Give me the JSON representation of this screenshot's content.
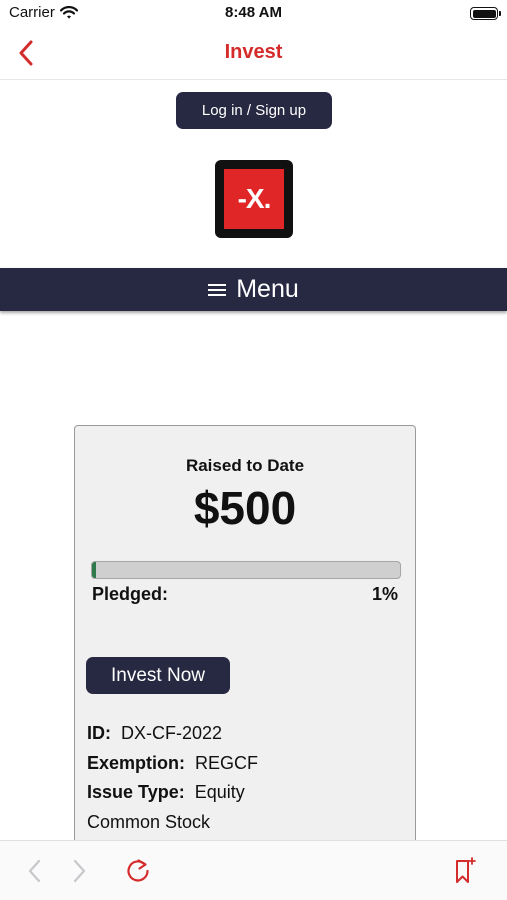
{
  "status_bar": {
    "carrier": "Carrier",
    "time": "8:48 AM"
  },
  "nav": {
    "title": "Invest",
    "accent_color": "#d42b2b"
  },
  "header": {
    "login_label": "Log in / Sign up",
    "logo_text": "-X."
  },
  "menu": {
    "label": "Menu",
    "bar_color": "#272842"
  },
  "campaign": {
    "raised_label": "Raised to Date",
    "raised_amount": "$500",
    "progress_fraction": 0.01,
    "pledged_label": "Pledged:",
    "pledged_percent": "1%",
    "invest_label": "Invest Now",
    "details": [
      {
        "key": "ID:",
        "value": "DX-CF-2022"
      },
      {
        "key": "Exemption:",
        "value": "REGCF"
      },
      {
        "key": "Issue Type:",
        "value": "Equity"
      },
      {
        "key": "",
        "value": "Common Stock"
      }
    ]
  },
  "toolbar": {
    "icons": [
      "back-arrow-icon",
      "forward-arrow-icon",
      "reload-icon",
      "add-bookmark-icon"
    ]
  }
}
